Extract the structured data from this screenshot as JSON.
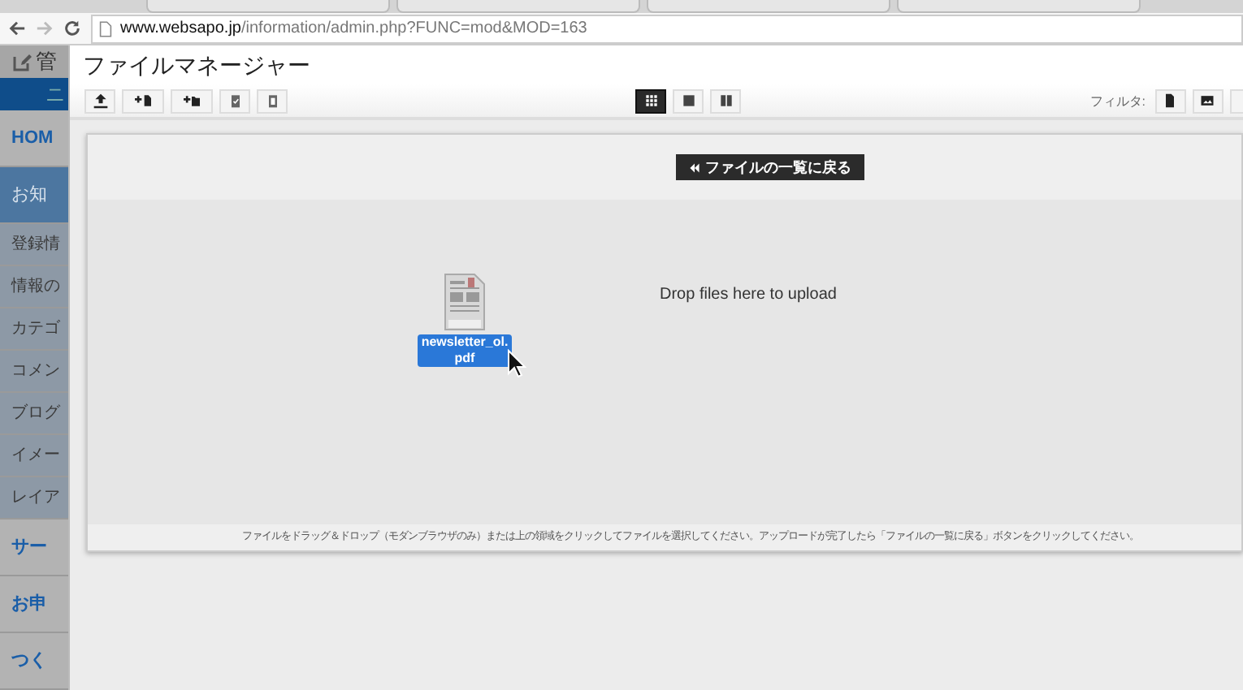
{
  "browser": {
    "url": "**www.websapo.jp**/information/admin.php?FUNC=mod&MOD=163"
  },
  "sidebar": {
    "header": "管",
    "banner": "ニ",
    "items": [
      {
        "label": "HOM",
        "kind": "main"
      },
      {
        "label": "お知",
        "kind": "active"
      },
      {
        "label": "登録情",
        "kind": "sub"
      },
      {
        "label": "情報の",
        "kind": "sub"
      },
      {
        "label": "カテゴ",
        "kind": "sub"
      },
      {
        "label": "コメン",
        "kind": "sub"
      },
      {
        "label": "ブログ",
        "kind": "sub"
      },
      {
        "label": "イメー",
        "kind": "sub"
      },
      {
        "label": "レイア",
        "kind": "sub"
      },
      {
        "label": "サー",
        "kind": "main"
      },
      {
        "label": "お申",
        "kind": "main"
      },
      {
        "label": "つく",
        "kind": "main"
      }
    ]
  },
  "modal": {
    "title": "ファイルマネージャー",
    "toolbar": {
      "actions": [
        {
          "kind": "upload"
        },
        {
          "kind": "new-file"
        },
        {
          "kind": "new-folder"
        },
        {
          "kind": "paste-check"
        },
        {
          "kind": "paste"
        }
      ],
      "views": [
        {
          "kind": "grid",
          "selected": true
        },
        {
          "kind": "list",
          "selected": false
        },
        {
          "kind": "columns",
          "selected": false
        }
      ],
      "filter_label": "フィルタ:",
      "filters": [
        {
          "kind": "file"
        },
        {
          "kind": "image"
        },
        {
          "kind": "more"
        }
      ]
    },
    "back_button": "ファイルの一覧に戻る",
    "files": [
      {
        "name": "newsletter_ol.pdf",
        "selected": true
      }
    ],
    "drop_hint": "Drop files here to upload",
    "footer_note": "ファイルをドラッグ＆ドロップ（モダンブラウザのみ）または上の領域をクリックしてファイルを選択してください。アップロードが完了したら「ファイルの一覧に戻る」ボタンをクリックしてください。"
  }
}
